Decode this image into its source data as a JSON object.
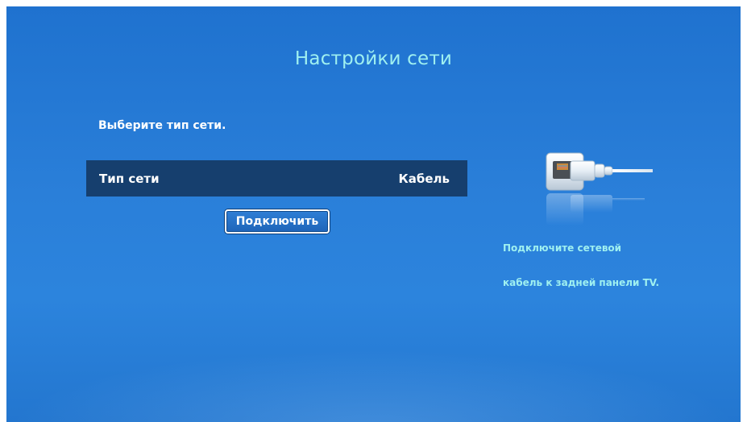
{
  "screen": {
    "title": "Настройки сети",
    "prompt": "Выберите тип сети."
  },
  "network_type": {
    "label": "Тип сети",
    "value": "Кабель"
  },
  "connect_button": {
    "label": "Подключить"
  },
  "hint": {
    "line1": "Подключите сетевой",
    "line2": "кабель к задней панели TV."
  },
  "colors": {
    "background": "#2a7fd9",
    "title": "#9ff0f0",
    "selected_row": "#163f6e",
    "hint": "#9ff0f0"
  }
}
